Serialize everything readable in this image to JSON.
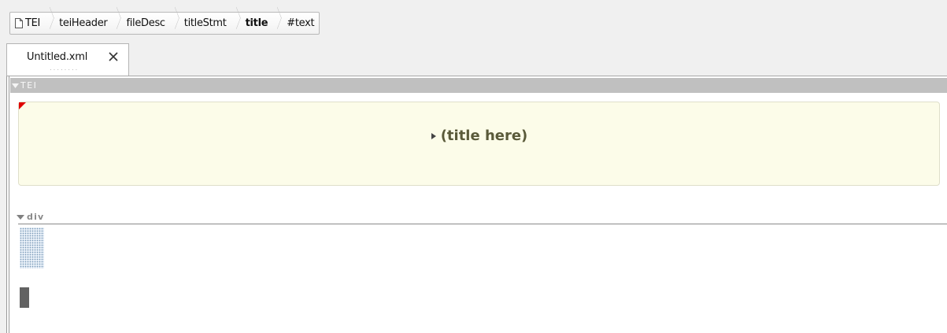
{
  "breadcrumb": {
    "items": [
      "TEI",
      "teiHeader",
      "fileDesc",
      "titleStmt",
      "title",
      "#text"
    ],
    "current": "title"
  },
  "tabs": [
    {
      "label": "Untitled.xml",
      "close_icon": "close-icon",
      "active": true
    }
  ],
  "editor": {
    "root_element": "TEI",
    "title_placeholder": "(title here)",
    "div_element": "div"
  },
  "colors": {
    "title_box_bg": "#fcfce9",
    "element_bar": "#c0c0c0",
    "error_marker": "#e00000",
    "title_text": "#5a5a3a"
  }
}
